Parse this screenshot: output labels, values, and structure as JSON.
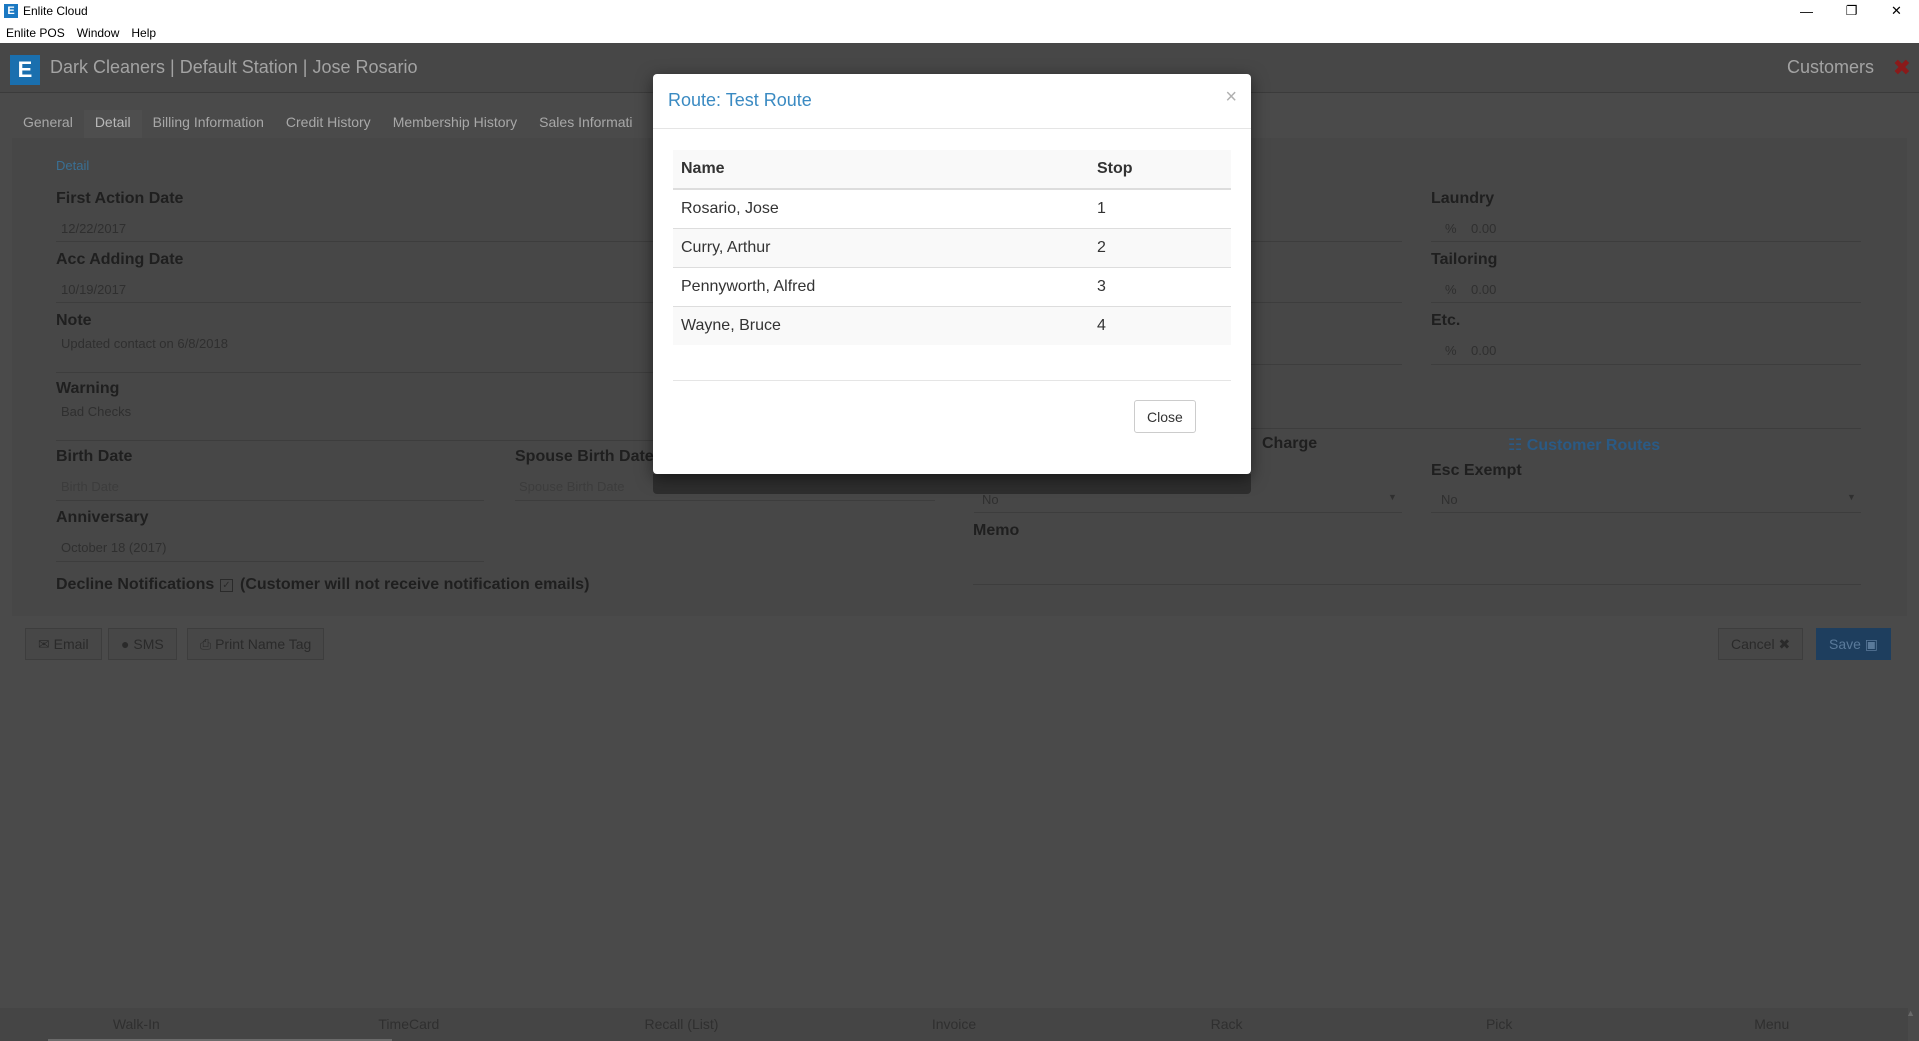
{
  "window": {
    "title": "Enlite Cloud",
    "menu": [
      "Enlite POS",
      "Window",
      "Help"
    ]
  },
  "header": {
    "title": "Dark Cleaners | Default Station | Jose Rosario",
    "section": "Customers"
  },
  "tabs": [
    "General",
    "Detail",
    "Billing Information",
    "Credit History",
    "Membership History",
    "Sales Informati"
  ],
  "detail": {
    "section_link": "Detail",
    "first_action_date_label": "First Action Date",
    "first_action_date": "12/22/2017",
    "acc_adding_date_label": "Acc Adding Date",
    "acc_adding_date": "10/19/2017",
    "note_label": "Note",
    "note": "Updated contact on 6/8/2018",
    "warning_label": "Warning",
    "warning": "Bad Checks",
    "birth_date_label": "Birth Date",
    "birth_date_placeholder": "Birth Date",
    "spouse_birth_date_label": "Spouse Birth Date",
    "spouse_birth_date_placeholder": "Spouse Birth Date",
    "anniversary_label": "Anniversary",
    "anniversary": "October 18 (2017)",
    "decline_notifications_label": "Decline Notifications",
    "decline_notifications_note": "(Customer will not receive notification emails)",
    "laundry_label": "Laundry",
    "laundry_value": "0.00",
    "tailoring_label": "Tailoring",
    "tailoring_value": "0.00",
    "etc_label": "Etc.",
    "etc_value": "0.00",
    "pct_symbol": "%",
    "charge_label": "Charge",
    "charge_value": "No",
    "customer_routes_link": "Customer Routes",
    "esc_exempt_label": "Esc Exempt",
    "esc_exempt_value": "No",
    "memo_label": "Memo"
  },
  "actions": {
    "email": "Email",
    "sms": "SMS",
    "print_name_tag": "Print Name Tag",
    "cancel": "Cancel",
    "save": "Save"
  },
  "bottom_nav": [
    "Walk-In",
    "TimeCard",
    "Recall (List)",
    "Invoice",
    "Rack",
    "Pick",
    "Menu"
  ],
  "modal": {
    "title": "Route: Test Route",
    "columns": [
      "Name",
      "Stop"
    ],
    "rows": [
      {
        "name": "Rosario, Jose",
        "stop": "1"
      },
      {
        "name": "Curry, Arthur",
        "stop": "2"
      },
      {
        "name": "Pennyworth, Alfred",
        "stop": "3"
      },
      {
        "name": "Wayne, Bruce",
        "stop": "4"
      }
    ],
    "close_label": "Close"
  }
}
